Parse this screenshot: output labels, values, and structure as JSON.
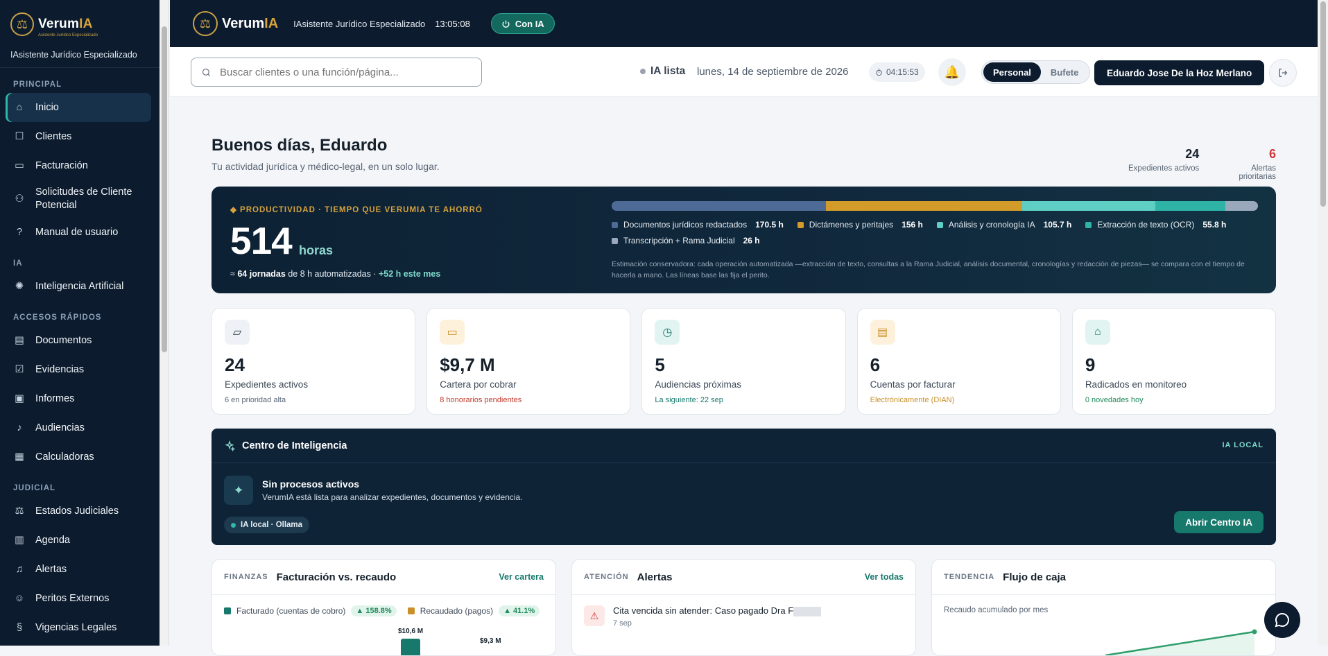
{
  "app": {
    "brand_main": "Verum",
    "brand_ia": "IA",
    "brand_tagline": "Asistente Jurídico Especializado",
    "subtitle": "IAsistente Jurídico Especializado"
  },
  "sidebar": {
    "sections": {
      "principal": "PRINCIPAL",
      "ia": "IA",
      "accesos": "ACCESOS RÁPIDOS",
      "judicial": "JUDICIAL"
    },
    "principal": [
      {
        "label": "Inicio",
        "icon": "home-icon"
      },
      {
        "label": "Clientes",
        "icon": "clients-icon"
      },
      {
        "label": "Facturación",
        "icon": "wallet-icon"
      },
      {
        "label": "Solicitudes de Cliente Potencial",
        "icon": "user-plus-icon"
      },
      {
        "label": "Manual de usuario",
        "icon": "help-icon"
      }
    ],
    "ia": [
      {
        "label": "Inteligencia Artificial",
        "icon": "brain-icon"
      }
    ],
    "accesos": [
      {
        "label": "Documentos",
        "icon": "document-icon"
      },
      {
        "label": "Evidencias",
        "icon": "evidence-icon"
      },
      {
        "label": "Informes",
        "icon": "briefcase-icon"
      },
      {
        "label": "Audiencias",
        "icon": "mic-icon"
      },
      {
        "label": "Calculadoras",
        "icon": "calculator-icon"
      }
    ],
    "judicial": [
      {
        "label": "Estados Judiciales",
        "icon": "scale-icon"
      },
      {
        "label": "Agenda",
        "icon": "calendar-icon"
      },
      {
        "label": "Alertas",
        "icon": "bell-icon"
      },
      {
        "label": "Peritos Externos",
        "icon": "expert-icon"
      },
      {
        "label": "Vigencias Legales",
        "icon": "law-icon"
      }
    ]
  },
  "topbar": {
    "subtitle": "IAsistente Jurídico Especializado",
    "clock": "13:05:08",
    "ai_toggle": "Con IA"
  },
  "header": {
    "search_placeholder": "Buscar clientes o una función/página...",
    "ia_status": "IA lista",
    "date": "lunes, 14 de septiembre de 2026",
    "timer": "04:15:53",
    "mode_personal": "Personal",
    "mode_bufete": "Bufete",
    "user": "Eduardo Jose De la Hoz Merlano"
  },
  "greeting": {
    "title": "Buenos días, Eduardo",
    "subtitle": "Tu actividad jurídica y médico-legal, en un solo lugar.",
    "stat1_value": "24",
    "stat1_label": "Expedientes activos",
    "stat2_value": "6",
    "stat2_label": "Alertas prioritarias"
  },
  "productivity": {
    "kicker": "◆ PRODUCTIVIDAD · TIEMPO QUE VERUMIA TE AHORRÓ",
    "hours": "514",
    "unit": "horas",
    "line_prefix": "≈",
    "line_bold": "64 jornadas",
    "line_mid": "de 8 h automatizadas ·",
    "line_plus": "+52 h este mes",
    "segments": [
      {
        "label": "Documentos jurídicos redactados",
        "value": "170.5 h",
        "hours": 170.5,
        "color": "#4e6a96"
      },
      {
        "label": "Dictámenes y peritajes",
        "value": "156 h",
        "hours": 156,
        "color": "#d39b2a"
      },
      {
        "label": "Análisis y cronología IA",
        "value": "105.7 h",
        "hours": 105.7,
        "color": "#5fcfc4"
      },
      {
        "label": "Extracción de texto (OCR)",
        "value": "55.8 h",
        "hours": 55.8,
        "color": "#2fb3a7"
      },
      {
        "label": "Transcripción + Rama Judicial",
        "value": "26 h",
        "hours": 26,
        "color": "#9aa8bb"
      }
    ],
    "note": "Estimación conservadora: cada operación automatizada —extracción de texto, consultas a la Rama Judicial, análisis documental, cronologías y redacción de piezas— se compara con el tiempo de hacerla a mano. Las líneas base las fija el perito."
  },
  "kpis": [
    {
      "value": "24",
      "label": "Expedientes activos",
      "sub": "6 en prioridad alta",
      "icon": "folder-icon",
      "icon_bg": "#eef1f5",
      "icon_color": "#2b3744",
      "sub_color": "#5a6675"
    },
    {
      "value": "$9,7 M",
      "label": "Cartera por cobrar",
      "sub": "8 honorarios pendientes",
      "icon": "wallet-icon",
      "icon_bg": "#fdf1dc",
      "icon_color": "#c9902a",
      "sub_color": "#c0392b"
    },
    {
      "value": "5",
      "label": "Audiencias próximas",
      "sub": "La siguiente: 22 sep",
      "icon": "calendar-clock-icon",
      "icon_bg": "#e1f4f1",
      "icon_color": "#17786c",
      "sub_color": "#17786c"
    },
    {
      "value": "6",
      "label": "Cuentas por facturar",
      "sub": "Electrónicamente (DIAN)",
      "icon": "receipt-icon",
      "icon_bg": "#fdf1dc",
      "icon_color": "#c9902a",
      "sub_color": "#c9902a"
    },
    {
      "value": "9",
      "label": "Radicados en monitoreo",
      "sub": "0 novedades hoy",
      "icon": "bank-icon",
      "icon_bg": "#e1f4f1",
      "icon_color": "#17786c",
      "sub_color": "#1f8a5b"
    }
  ],
  "intel": {
    "title": "Centro de Inteligencia",
    "tag": "IA LOCAL",
    "status_title": "Sin procesos activos",
    "status_desc": "VerumIA está lista para analizar expedientes, documentos y evidencia.",
    "chip": "IA local · Ollama",
    "button": "Abrir Centro IA"
  },
  "panels": {
    "finanzas": {
      "kicker": "FINANZAS",
      "title": "Facturación vs. recaudo",
      "action": "Ver cartera",
      "legend1": "Facturado (cuentas de cobro)",
      "badge1": "▲ 158.8%",
      "legend2": "Recaudado (pagos)",
      "badge2": "▲ 41.1%",
      "bar1_label": "$10,6 M",
      "bar2_label": "$9,3 M"
    },
    "alertas": {
      "kicker": "ATENCIÓN",
      "title": "Alertas",
      "action": "Ver todas",
      "item_title": "Cita vencida sin atender: Caso pagado Dra F",
      "item_date": "7 sep"
    },
    "tendencia": {
      "kicker": "TENDENCIA",
      "title": "Flujo de caja",
      "subtitle": "Recaudo acumulado por mes"
    }
  }
}
